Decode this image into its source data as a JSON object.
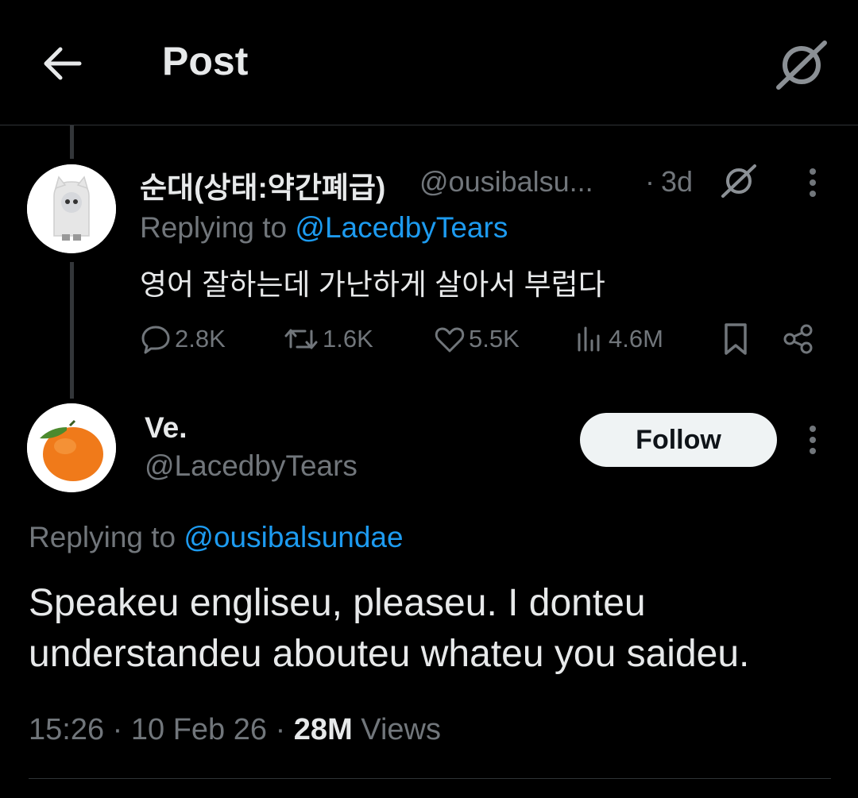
{
  "header": {
    "title": "Post",
    "back_icon": "arrow-left-icon",
    "grok_icon": "grok-icon"
  },
  "reply_tweet": {
    "display_name": "순대(상태:약간폐급)",
    "handle": "@ousibalsu...",
    "separator": "·",
    "time": "3d",
    "replying_prefix": "Replying to",
    "replying_to": "@LacedbyTears",
    "text": "영어 잘하는데 가난하게 살아서 부럽다",
    "stats": {
      "replies": "2.8K",
      "reposts": "1.6K",
      "likes": "5.5K",
      "views": "4.6M"
    }
  },
  "main_tweet": {
    "display_name": "Ve.",
    "handle": "@LacedbyTears",
    "follow_label": "Follow",
    "replying_prefix": "Replying to",
    "replying_to": "@ousibalsundae",
    "text": "Speakeu engliseu, pleaseu. I donteu understandeu abouteu whateu you saideu.",
    "time": "15:26",
    "date": "10 Feb 26",
    "sep": "·",
    "views_count": "28M",
    "views_label": "Views"
  },
  "colors": {
    "background": "#000000",
    "text": "#e7e9ea",
    "muted": "#71767b",
    "link": "#1d9bf0",
    "follow_bg": "#eff3f4"
  }
}
